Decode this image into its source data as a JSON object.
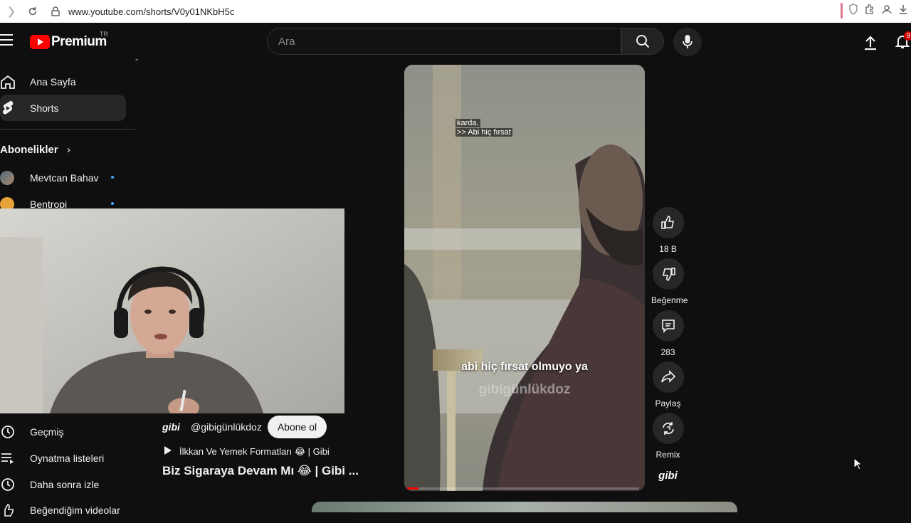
{
  "browser": {
    "url": "www.youtube.com/shorts/V0y01NKbH5c"
  },
  "header": {
    "logo_text": "Premium",
    "logo_region": "TR",
    "search_placeholder": "Ara",
    "notification_count": "9"
  },
  "sidebar": {
    "items": [
      {
        "label": "Ana Sayfa",
        "icon": "home-icon"
      },
      {
        "label": "Shorts",
        "icon": "shorts-icon"
      }
    ],
    "subscriptions_title": "Abonelikler",
    "subscriptions": [
      {
        "label": "Mevtcan Bahav"
      },
      {
        "label": "Bentropi"
      }
    ],
    "you_items": [
      {
        "label": "Geçmiş",
        "icon": "history-icon"
      },
      {
        "label": "Oynatma listeleri",
        "icon": "playlists-icon"
      },
      {
        "label": "Daha sonra izle",
        "icon": "watch-later-icon"
      },
      {
        "label": "Beğendiğim videolar",
        "icon": "liked-videos-icon"
      }
    ]
  },
  "short": {
    "channel_logo": "gibi",
    "channel_handle": "@gibigünlükdoz",
    "subscribe_label": "Abone ol",
    "playlist": "İlkkan Ve Yemek Formatları 😂 | Gibi",
    "title": "Biz Sigaraya Devam Mı 😂 | Gibi ...",
    "caption_top_line1": "karda.",
    "caption_top_line2": ">> Abi hiç fırsat",
    "subtitle": "abi hiç fırsat olmuyo ya",
    "watermark": "gibigünlükdoz",
    "progress": 0.05
  },
  "actions": {
    "like_count": "18 B",
    "dislike_label": "Beğenme",
    "comment_count": "283",
    "share_label": "Paylaş",
    "remix_label": "Remix",
    "channel_badge": "gibi"
  }
}
